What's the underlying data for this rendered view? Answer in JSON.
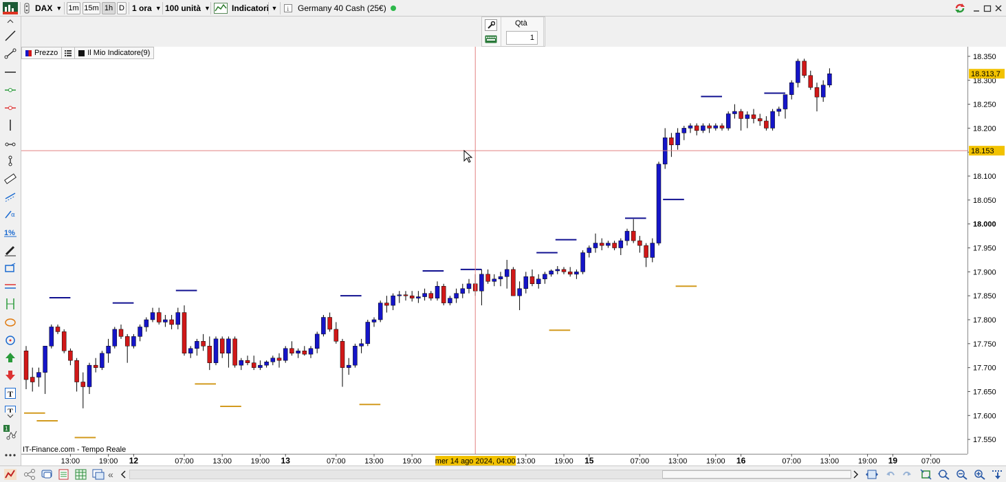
{
  "toolbar": {
    "symbol": "DAX",
    "timeframes": [
      "1m",
      "15m",
      "1h",
      "D"
    ],
    "active_timeframe": "1h",
    "interval": "1 ora",
    "units": "100 unità",
    "indicators_label": "Indicatori",
    "instrument": "Germany 40 Cash (25€)",
    "status_color": "#2db84a",
    "window_buttons": [
      "minimize-icon",
      "maximize-icon",
      "close-icon"
    ]
  },
  "order_panel": {
    "qty_label": "Qtà",
    "qty_value": "1"
  },
  "legend": {
    "price_label": "Prezzo",
    "indicator_label": "Il Mio Indicatore(9)"
  },
  "watermark": "IT-Finance.com - Tempo Reale",
  "colors": {
    "bull": "#1515c8",
    "bear": "#d01818",
    "indicator_high": "#101090",
    "indicator_low": "#d29a1e",
    "crosshair": "#e08080",
    "price_badge": "#f2c200"
  },
  "chart_data": {
    "type": "candlestick",
    "instrument": "DAX",
    "timeframe": "1h",
    "ylim": [
      17520,
      18370
    ],
    "y_ticks": [
      17550,
      17600,
      17650,
      17700,
      17750,
      17800,
      17850,
      17900,
      17950,
      18000,
      18050,
      18100,
      18150,
      18200,
      18250,
      18300,
      18350
    ],
    "y_tick_labels": [
      "17.550",
      "17.600",
      "17.650",
      "17.700",
      "17.750",
      "17.800",
      "17.850",
      "17.900",
      "17.950",
      "18.000",
      "18.050",
      "18.100",
      "18.150",
      "18.200",
      "18.250",
      "18.300",
      "18.350"
    ],
    "y_bold_tick": "18.000",
    "last_price_label": "18.313,7",
    "last_price": 18313.7,
    "crosshair_price_label": "18.153",
    "crosshair_price": 18153,
    "crosshair_time_label": "mer 14 ago 2024, 04:00",
    "crosshair_bar_index": 71,
    "x_ticks": [
      {
        "label": "13:00",
        "bar": 7
      },
      {
        "label": "19:00",
        "bar": 13
      },
      {
        "label": "12",
        "bar": 17,
        "bold": true
      },
      {
        "label": "07:00",
        "bar": 25
      },
      {
        "label": "13:00",
        "bar": 31
      },
      {
        "label": "19:00",
        "bar": 37
      },
      {
        "label": "13",
        "bar": 41,
        "bold": true
      },
      {
        "label": "07:00",
        "bar": 49
      },
      {
        "label": "13:00",
        "bar": 55
      },
      {
        "label": "19:00",
        "bar": 61
      },
      {
        "label": "13:00",
        "bar": 79
      },
      {
        "label": "19:00",
        "bar": 85
      },
      {
        "label": "15",
        "bar": 89,
        "bold": true
      },
      {
        "label": "07:00",
        "bar": 97
      },
      {
        "label": "13:00",
        "bar": 103
      },
      {
        "label": "19:00",
        "bar": 109
      },
      {
        "label": "16",
        "bar": 113,
        "bold": true
      },
      {
        "label": "07:00",
        "bar": 121
      },
      {
        "label": "13:00",
        "bar": 127
      },
      {
        "label": "19:00",
        "bar": 133
      },
      {
        "label": "19",
        "bar": 137,
        "bold": true
      },
      {
        "label": "07:00",
        "bar": 143
      }
    ],
    "candles": [
      [
        17735,
        17745,
        17655,
        17675
      ],
      [
        17680,
        17700,
        17650,
        17670
      ],
      [
        17680,
        17700,
        17660,
        17690
      ],
      [
        17690,
        17745,
        17645,
        17745
      ],
      [
        17745,
        17790,
        17740,
        17785
      ],
      [
        17785,
        17790,
        17770,
        17775
      ],
      [
        17775,
        17780,
        17730,
        17735
      ],
      [
        17735,
        17740,
        17705,
        17715
      ],
      [
        17715,
        17720,
        17650,
        17670
      ],
      [
        17670,
        17690,
        17615,
        17660
      ],
      [
        17660,
        17710,
        17645,
        17705
      ],
      [
        17705,
        17720,
        17690,
        17700
      ],
      [
        17700,
        17735,
        17695,
        17730
      ],
      [
        17730,
        17760,
        17710,
        17745
      ],
      [
        17745,
        17785,
        17740,
        17780
      ],
      [
        17780,
        17790,
        17760,
        17765
      ],
      [
        17765,
        17770,
        17710,
        17745
      ],
      [
        17745,
        17770,
        17740,
        17765
      ],
      [
        17765,
        17790,
        17755,
        17785
      ],
      [
        17785,
        17805,
        17775,
        17800
      ],
      [
        17800,
        17825,
        17795,
        17815
      ],
      [
        17815,
        17825,
        17790,
        17795
      ],
      [
        17795,
        17810,
        17785,
        17800
      ],
      [
        17800,
        17810,
        17780,
        17790
      ],
      [
        17790,
        17825,
        17780,
        17815
      ],
      [
        17815,
        17830,
        17725,
        17730
      ],
      [
        17730,
        17745,
        17720,
        17740
      ],
      [
        17740,
        17760,
        17725,
        17755
      ],
      [
        17755,
        17770,
        17735,
        17745
      ],
      [
        17745,
        17765,
        17695,
        17710
      ],
      [
        17710,
        17765,
        17705,
        17760
      ],
      [
        17760,
        17765,
        17720,
        17730
      ],
      [
        17730,
        17765,
        17700,
        17760
      ],
      [
        17760,
        17765,
        17700,
        17705
      ],
      [
        17705,
        17720,
        17695,
        17715
      ],
      [
        17715,
        17725,
        17705,
        17710
      ],
      [
        17710,
        17725,
        17695,
        17700
      ],
      [
        17700,
        17715,
        17695,
        17705
      ],
      [
        17705,
        17715,
        17700,
        17712
      ],
      [
        17712,
        17725,
        17705,
        17720
      ],
      [
        17720,
        17730,
        17700,
        17715
      ],
      [
        17715,
        17745,
        17710,
        17740
      ],
      [
        17740,
        17755,
        17725,
        17730
      ],
      [
        17730,
        17740,
        17720,
        17735
      ],
      [
        17735,
        17745,
        17725,
        17728
      ],
      [
        17728,
        17745,
        17720,
        17740
      ],
      [
        17740,
        17775,
        17730,
        17770
      ],
      [
        17770,
        17810,
        17765,
        17805
      ],
      [
        17805,
        17815,
        17775,
        17780
      ],
      [
        17780,
        17795,
        17750,
        17755
      ],
      [
        17755,
        17760,
        17660,
        17700
      ],
      [
        17700,
        17720,
        17685,
        17705
      ],
      [
        17705,
        17750,
        17700,
        17745
      ],
      [
        17745,
        17760,
        17730,
        17750
      ],
      [
        17750,
        17800,
        17745,
        17795
      ],
      [
        17795,
        17805,
        17785,
        17800
      ],
      [
        17800,
        17840,
        17795,
        17835
      ],
      [
        17835,
        17850,
        17815,
        17830
      ],
      [
        17830,
        17855,
        17820,
        17850
      ],
      [
        17850,
        17860,
        17835,
        17852
      ],
      [
        17852,
        17860,
        17840,
        17850
      ],
      [
        17850,
        17860,
        17838,
        17845
      ],
      [
        17845,
        17860,
        17835,
        17848
      ],
      [
        17848,
        17865,
        17840,
        17855
      ],
      [
        17855,
        17860,
        17840,
        17845
      ],
      [
        17845,
        17880,
        17840,
        17870
      ],
      [
        17870,
        17875,
        17830,
        17835
      ],
      [
        17835,
        17850,
        17830,
        17845
      ],
      [
        17845,
        17865,
        17835,
        17855
      ],
      [
        17855,
        17875,
        17845,
        17865
      ],
      [
        17865,
        17885,
        17855,
        17875
      ],
      [
        17875,
        17895,
        17850,
        17860
      ],
      [
        17860,
        17905,
        17830,
        17895
      ],
      [
        17895,
        17905,
        17875,
        17880
      ],
      [
        17880,
        17895,
        17870,
        17885
      ],
      [
        17885,
        17900,
        17870,
        17890
      ],
      [
        17890,
        17925,
        17865,
        17905
      ],
      [
        17905,
        17910,
        17850,
        17850
      ],
      [
        17850,
        17880,
        17820,
        17865
      ],
      [
        17865,
        17900,
        17855,
        17890
      ],
      [
        17890,
        17905,
        17870,
        17875
      ],
      [
        17875,
        17895,
        17865,
        17885
      ],
      [
        17885,
        17900,
        17875,
        17895
      ],
      [
        17895,
        17905,
        17890,
        17902
      ],
      [
        17902,
        17912,
        17895,
        17905
      ],
      [
        17905,
        17910,
        17895,
        17900
      ],
      [
        17900,
        17910,
        17890,
        17895
      ],
      [
        17895,
        17905,
        17885,
        17900
      ],
      [
        17900,
        17945,
        17895,
        17940
      ],
      [
        17940,
        17955,
        17930,
        17950
      ],
      [
        17950,
        17980,
        17940,
        17960
      ],
      [
        17960,
        17970,
        17945,
        17955
      ],
      [
        17955,
        17965,
        17950,
        17960
      ],
      [
        17960,
        17965,
        17945,
        17950
      ],
      [
        17950,
        17970,
        17935,
        17965
      ],
      [
        17965,
        17990,
        17955,
        17985
      ],
      [
        17985,
        18010,
        17960,
        17965
      ],
      [
        17965,
        17975,
        17940,
        17955
      ],
      [
        17955,
        17960,
        17910,
        17930
      ],
      [
        17930,
        17970,
        17920,
        17960
      ],
      [
        17960,
        18130,
        17955,
        18125
      ],
      [
        18125,
        18200,
        18115,
        18180
      ],
      [
        18180,
        18190,
        18140,
        18165
      ],
      [
        18165,
        18200,
        18155,
        18190
      ],
      [
        18190,
        18205,
        18175,
        18200
      ],
      [
        18200,
        18210,
        18190,
        18205
      ],
      [
        18205,
        18210,
        18185,
        18195
      ],
      [
        18195,
        18210,
        18190,
        18205
      ],
      [
        18205,
        18210,
        18190,
        18200
      ],
      [
        18200,
        18210,
        18195,
        18205
      ],
      [
        18205,
        18210,
        18195,
        18200
      ],
      [
        18200,
        18235,
        18195,
        18230
      ],
      [
        18230,
        18250,
        18220,
        18235
      ],
      [
        18235,
        18240,
        18195,
        18220
      ],
      [
        18220,
        18235,
        18200,
        18228
      ],
      [
        18228,
        18240,
        18210,
        18220
      ],
      [
        18220,
        18230,
        18205,
        18215
      ],
      [
        18215,
        18225,
        18195,
        18200
      ],
      [
        18200,
        18240,
        18195,
        18235
      ],
      [
        18235,
        18245,
        18225,
        18240
      ],
      [
        18240,
        18270,
        18220,
        18270
      ],
      [
        18270,
        18300,
        18260,
        18295
      ],
      [
        18295,
        18345,
        18285,
        18340
      ],
      [
        18340,
        18345,
        18305,
        18310
      ],
      [
        18310,
        18320,
        18280,
        18285
      ],
      [
        18285,
        18295,
        18235,
        18265
      ],
      [
        18265,
        18300,
        18255,
        18290
      ],
      [
        18290,
        18325,
        18285,
        18313.7
      ]
    ],
    "indicator_high": [
      {
        "from": 4,
        "to": 7,
        "value": 17846
      },
      {
        "from": 14,
        "to": 17,
        "value": 17835
      },
      {
        "from": 24,
        "to": 27,
        "value": 17861
      },
      {
        "from": 50,
        "to": 53,
        "value": 17850
      },
      {
        "from": 63,
        "to": 66,
        "value": 17902
      },
      {
        "from": 69,
        "to": 72,
        "value": 17905
      },
      {
        "from": 81,
        "to": 84,
        "value": 17940
      },
      {
        "from": 84,
        "to": 87,
        "value": 17967
      },
      {
        "from": 95,
        "to": 98,
        "value": 18012
      },
      {
        "from": 101,
        "to": 104,
        "value": 18051
      },
      {
        "from": 107,
        "to": 110,
        "value": 18266
      },
      {
        "from": 117,
        "to": 120,
        "value": 18273
      }
    ],
    "indicator_low": [
      {
        "from": 0,
        "to": 3,
        "value": 17605
      },
      {
        "from": 2,
        "to": 5,
        "value": 17589
      },
      {
        "from": 8,
        "to": 11,
        "value": 17554
      },
      {
        "from": 27,
        "to": 30,
        "value": 17666
      },
      {
        "from": 31,
        "to": 34,
        "value": 17619
      },
      {
        "from": 53,
        "to": 56,
        "value": 17623
      },
      {
        "from": 83,
        "to": 86,
        "value": 17778
      },
      {
        "from": 103,
        "to": 106,
        "value": 17870
      }
    ]
  }
}
